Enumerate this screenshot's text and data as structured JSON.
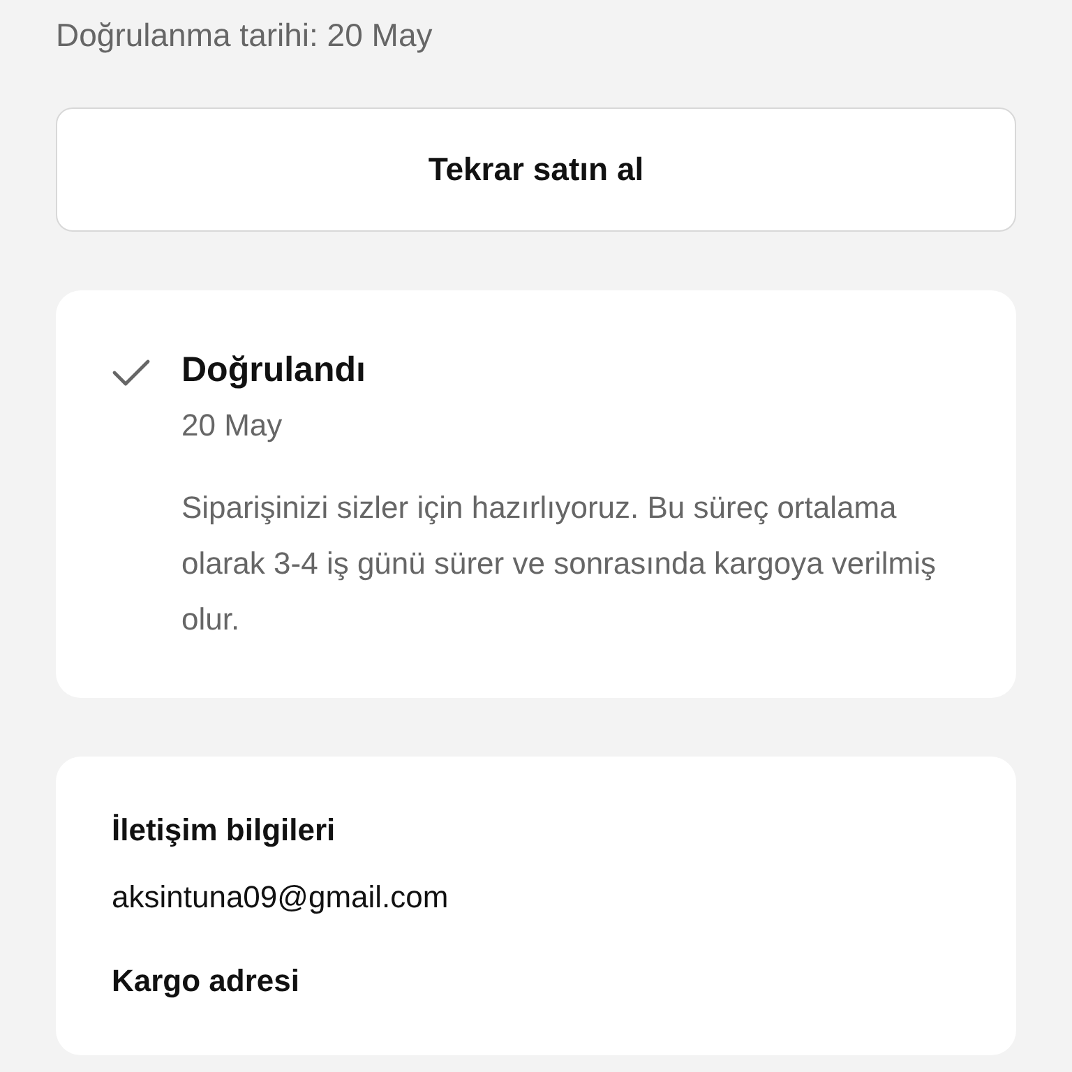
{
  "header": {
    "subtitle": "Doğrulanma tarihi: 20 May"
  },
  "buy_again_button": "Tekrar satın al",
  "status_card": {
    "title": "Doğrulandı",
    "date": "20 May",
    "description": "Siparişinizi sizler için hazırlıyoruz. Bu süreç ortalama olarak 3-4 iş günü sürer ve sonrasında kargoya verilmiş olur."
  },
  "info_card": {
    "sections": [
      {
        "heading": "İletişim bilgileri",
        "value": "aksintuna09@gmail.com"
      },
      {
        "heading": "Kargo adresi"
      }
    ]
  }
}
